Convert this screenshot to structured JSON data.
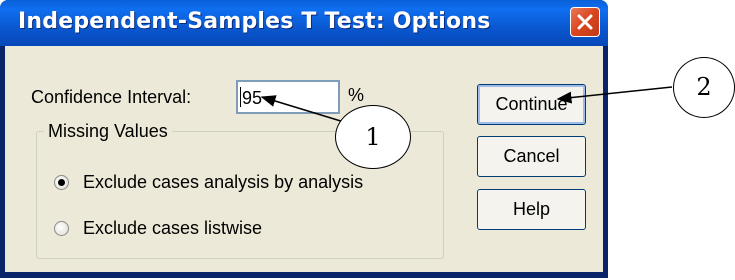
{
  "window": {
    "title": "Independent-Samples T Test: Options",
    "close_icon": "close-icon"
  },
  "confidence_interval": {
    "label": "Confidence Interval:",
    "value": "95",
    "unit": "%"
  },
  "missing_values": {
    "group_label": "Missing Values",
    "options": [
      {
        "label": "Exclude cases analysis by analysis",
        "selected": true
      },
      {
        "label": "Exclude cases listwise",
        "selected": false
      }
    ]
  },
  "buttons": {
    "continue_label": "Continue",
    "cancel_label": "Cancel",
    "help_label": "Help"
  },
  "callouts": [
    "1",
    "2"
  ],
  "colors": {
    "titlebar": "#0a58d0",
    "dialog_face": "#ece9d8",
    "close_button": "#d9451f"
  }
}
